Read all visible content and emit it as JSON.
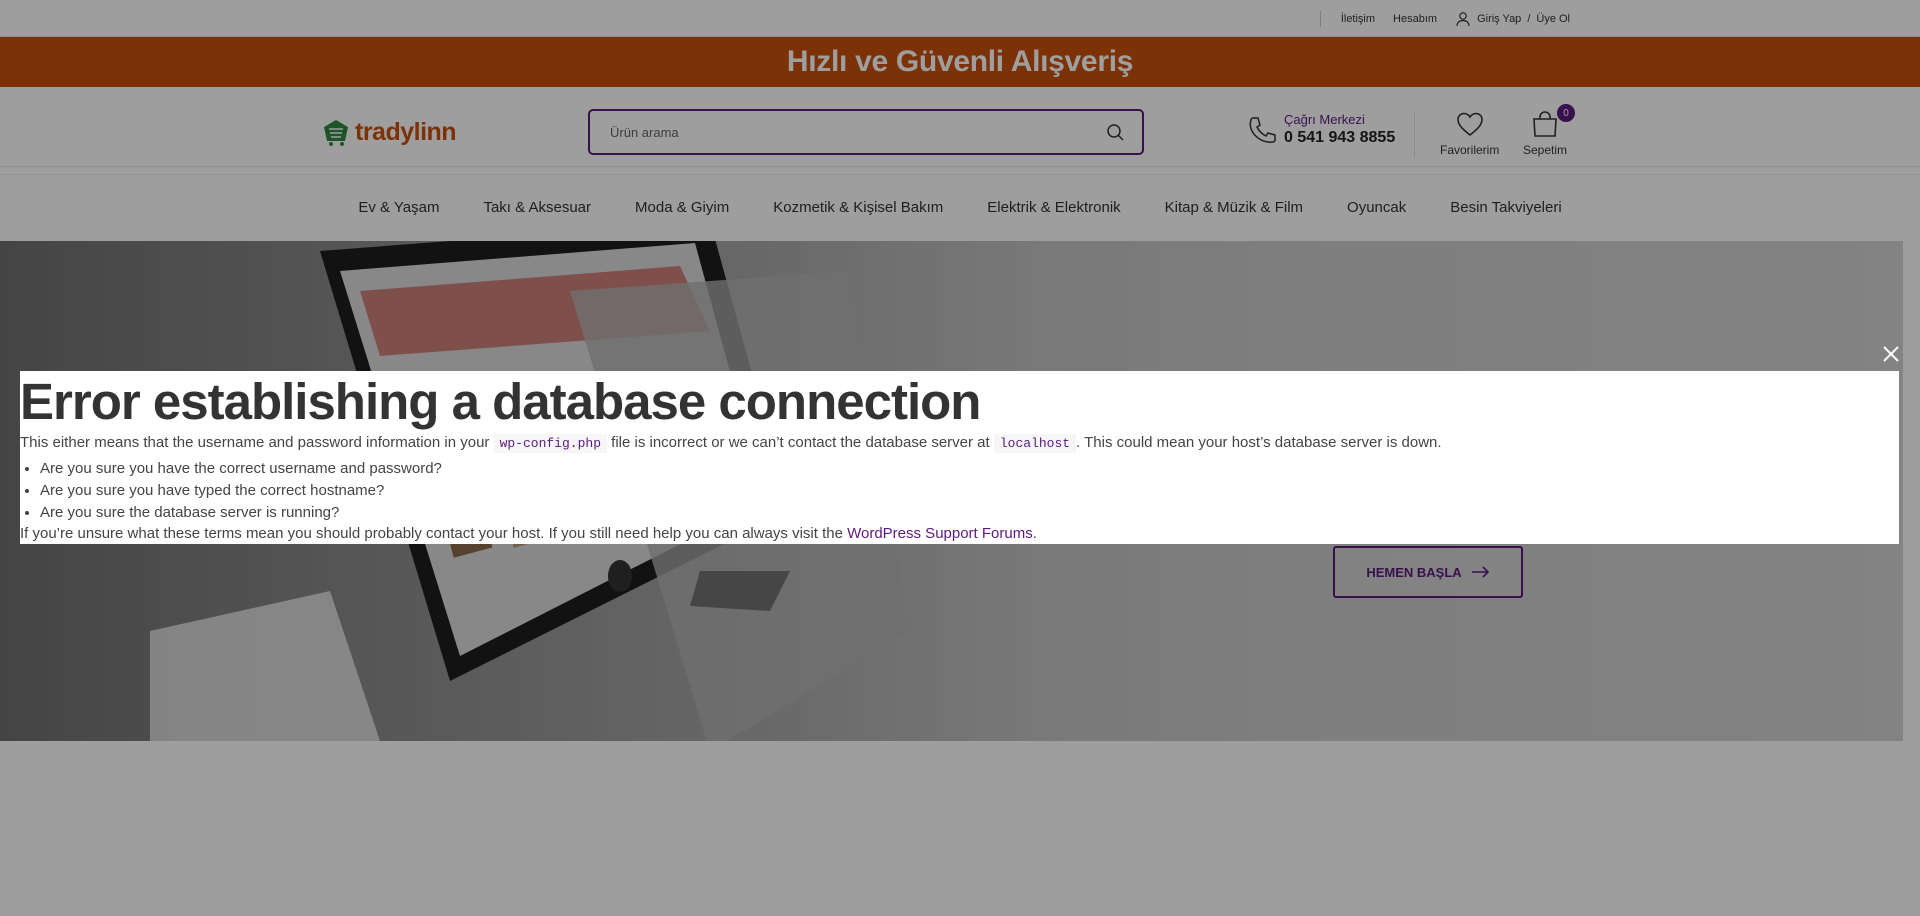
{
  "topbar": {
    "contact": "İletişim",
    "account": "Hesabım",
    "login": "Giriş Yap",
    "login_sep": "/",
    "register": "Üye Ol"
  },
  "promo": {
    "text": "Hızlı ve Güvenli Alışveriş"
  },
  "header": {
    "logo_text": "tradylinn",
    "search_placeholder": "Ürün arama",
    "call_center_label": "Çağrı Merkezi",
    "call_center_number": "0 541 943 8855",
    "favorites_label": "Favorilerim",
    "cart_label": "Sepetim",
    "cart_count": "0"
  },
  "nav": {
    "categories": [
      "Ev & Yaşam",
      "Takı & Aksesuar",
      "Moda & Giyim",
      "Kozmetik & Kişisel Bakım",
      "Elektrik & Elektronik",
      "Kitap & Müzik & Film",
      "Oyuncak",
      "Besin Takviyeleri"
    ]
  },
  "hero": {
    "cta_label": "HEMEN BAŞLA"
  },
  "error": {
    "title": "Error establishing a database connection",
    "p1_before": "This either means that the username and password information in your ",
    "p1_code1": "wp-config.php",
    "p1_middle": " file is incorrect or we can’t contact the database server at ",
    "p1_code2": "localhost",
    "p1_after": ". This could mean your host’s database server is down.",
    "items": [
      "Are you sure you have the correct username and password?",
      "Are you sure you have typed the correct hostname?",
      "Are you sure the database server is running?"
    ],
    "p2_before": "If you’re unsure what these terms mean you should probably contact your host. If you still need help you can always visit the ",
    "p2_link": "WordPress Support Forums",
    "p2_after": "."
  },
  "colors": {
    "brand_purple": "#5b1b7e",
    "brand_orange": "#c8510a"
  }
}
